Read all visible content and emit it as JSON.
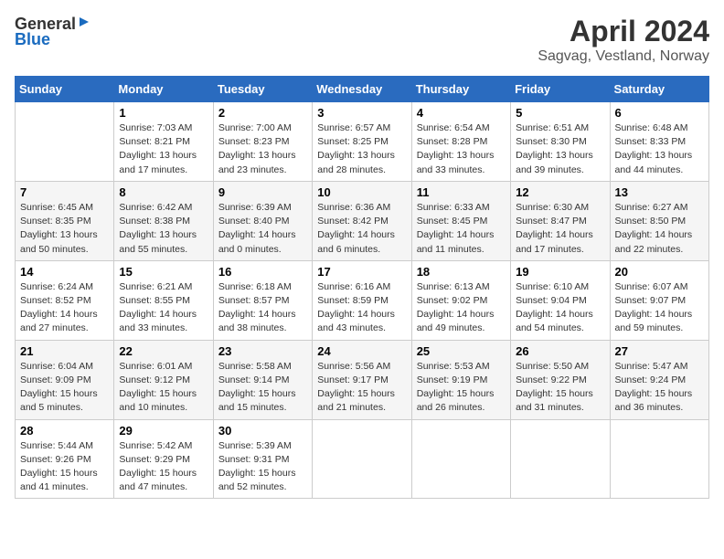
{
  "header": {
    "logo_general": "General",
    "logo_blue": "Blue",
    "month_year": "April 2024",
    "location": "Sagvag, Vestland, Norway"
  },
  "calendar": {
    "days_of_week": [
      "Sunday",
      "Monday",
      "Tuesday",
      "Wednesday",
      "Thursday",
      "Friday",
      "Saturday"
    ],
    "weeks": [
      [
        {
          "day": "",
          "info": ""
        },
        {
          "day": "1",
          "info": "Sunrise: 7:03 AM\nSunset: 8:21 PM\nDaylight: 13 hours\nand 17 minutes."
        },
        {
          "day": "2",
          "info": "Sunrise: 7:00 AM\nSunset: 8:23 PM\nDaylight: 13 hours\nand 23 minutes."
        },
        {
          "day": "3",
          "info": "Sunrise: 6:57 AM\nSunset: 8:25 PM\nDaylight: 13 hours\nand 28 minutes."
        },
        {
          "day": "4",
          "info": "Sunrise: 6:54 AM\nSunset: 8:28 PM\nDaylight: 13 hours\nand 33 minutes."
        },
        {
          "day": "5",
          "info": "Sunrise: 6:51 AM\nSunset: 8:30 PM\nDaylight: 13 hours\nand 39 minutes."
        },
        {
          "day": "6",
          "info": "Sunrise: 6:48 AM\nSunset: 8:33 PM\nDaylight: 13 hours\nand 44 minutes."
        }
      ],
      [
        {
          "day": "7",
          "info": "Sunrise: 6:45 AM\nSunset: 8:35 PM\nDaylight: 13 hours\nand 50 minutes."
        },
        {
          "day": "8",
          "info": "Sunrise: 6:42 AM\nSunset: 8:38 PM\nDaylight: 13 hours\nand 55 minutes."
        },
        {
          "day": "9",
          "info": "Sunrise: 6:39 AM\nSunset: 8:40 PM\nDaylight: 14 hours\nand 0 minutes."
        },
        {
          "day": "10",
          "info": "Sunrise: 6:36 AM\nSunset: 8:42 PM\nDaylight: 14 hours\nand 6 minutes."
        },
        {
          "day": "11",
          "info": "Sunrise: 6:33 AM\nSunset: 8:45 PM\nDaylight: 14 hours\nand 11 minutes."
        },
        {
          "day": "12",
          "info": "Sunrise: 6:30 AM\nSunset: 8:47 PM\nDaylight: 14 hours\nand 17 minutes."
        },
        {
          "day": "13",
          "info": "Sunrise: 6:27 AM\nSunset: 8:50 PM\nDaylight: 14 hours\nand 22 minutes."
        }
      ],
      [
        {
          "day": "14",
          "info": "Sunrise: 6:24 AM\nSunset: 8:52 PM\nDaylight: 14 hours\nand 27 minutes."
        },
        {
          "day": "15",
          "info": "Sunrise: 6:21 AM\nSunset: 8:55 PM\nDaylight: 14 hours\nand 33 minutes."
        },
        {
          "day": "16",
          "info": "Sunrise: 6:18 AM\nSunset: 8:57 PM\nDaylight: 14 hours\nand 38 minutes."
        },
        {
          "day": "17",
          "info": "Sunrise: 6:16 AM\nSunset: 8:59 PM\nDaylight: 14 hours\nand 43 minutes."
        },
        {
          "day": "18",
          "info": "Sunrise: 6:13 AM\nSunset: 9:02 PM\nDaylight: 14 hours\nand 49 minutes."
        },
        {
          "day": "19",
          "info": "Sunrise: 6:10 AM\nSunset: 9:04 PM\nDaylight: 14 hours\nand 54 minutes."
        },
        {
          "day": "20",
          "info": "Sunrise: 6:07 AM\nSunset: 9:07 PM\nDaylight: 14 hours\nand 59 minutes."
        }
      ],
      [
        {
          "day": "21",
          "info": "Sunrise: 6:04 AM\nSunset: 9:09 PM\nDaylight: 15 hours\nand 5 minutes."
        },
        {
          "day": "22",
          "info": "Sunrise: 6:01 AM\nSunset: 9:12 PM\nDaylight: 15 hours\nand 10 minutes."
        },
        {
          "day": "23",
          "info": "Sunrise: 5:58 AM\nSunset: 9:14 PM\nDaylight: 15 hours\nand 15 minutes."
        },
        {
          "day": "24",
          "info": "Sunrise: 5:56 AM\nSunset: 9:17 PM\nDaylight: 15 hours\nand 21 minutes."
        },
        {
          "day": "25",
          "info": "Sunrise: 5:53 AM\nSunset: 9:19 PM\nDaylight: 15 hours\nand 26 minutes."
        },
        {
          "day": "26",
          "info": "Sunrise: 5:50 AM\nSunset: 9:22 PM\nDaylight: 15 hours\nand 31 minutes."
        },
        {
          "day": "27",
          "info": "Sunrise: 5:47 AM\nSunset: 9:24 PM\nDaylight: 15 hours\nand 36 minutes."
        }
      ],
      [
        {
          "day": "28",
          "info": "Sunrise: 5:44 AM\nSunset: 9:26 PM\nDaylight: 15 hours\nand 41 minutes."
        },
        {
          "day": "29",
          "info": "Sunrise: 5:42 AM\nSunset: 9:29 PM\nDaylight: 15 hours\nand 47 minutes."
        },
        {
          "day": "30",
          "info": "Sunrise: 5:39 AM\nSunset: 9:31 PM\nDaylight: 15 hours\nand 52 minutes."
        },
        {
          "day": "",
          "info": ""
        },
        {
          "day": "",
          "info": ""
        },
        {
          "day": "",
          "info": ""
        },
        {
          "day": "",
          "info": ""
        }
      ]
    ]
  }
}
